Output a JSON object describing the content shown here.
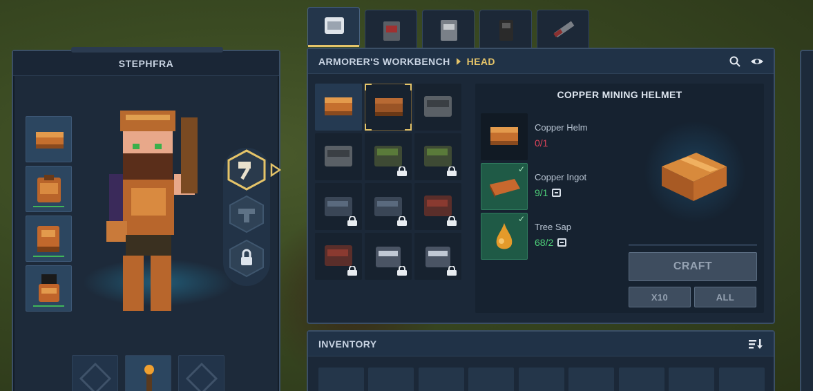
{
  "character": {
    "name": "STEPHFRA"
  },
  "workbench": {
    "title": "ARMORER'S WORKBENCH",
    "category": "HEAD",
    "tabs": [
      {
        "name": "head",
        "active": true
      },
      {
        "name": "chest",
        "active": false
      },
      {
        "name": "hands",
        "active": false
      },
      {
        "name": "legs",
        "active": false
      },
      {
        "name": "weapons",
        "active": false
      }
    ]
  },
  "recipe": {
    "title": "COPPER MINING HELMET",
    "ingredients": [
      {
        "name": "Copper Helm",
        "count": "0/1",
        "satisfied": false
      },
      {
        "name": "Copper Ingot",
        "count": "9/1",
        "satisfied": true
      },
      {
        "name": "Tree Sap",
        "count": "68/2",
        "satisfied": true
      }
    ],
    "craft_label": "CRAFT",
    "x10_label": "X10",
    "all_label": "ALL"
  },
  "inventory": {
    "title": "INVENTORY"
  },
  "colors": {
    "accent_gold": "#e5c469",
    "ok_green": "#3fb65a",
    "need_red": "#e0445a",
    "panel_bg": "#1b2838"
  }
}
